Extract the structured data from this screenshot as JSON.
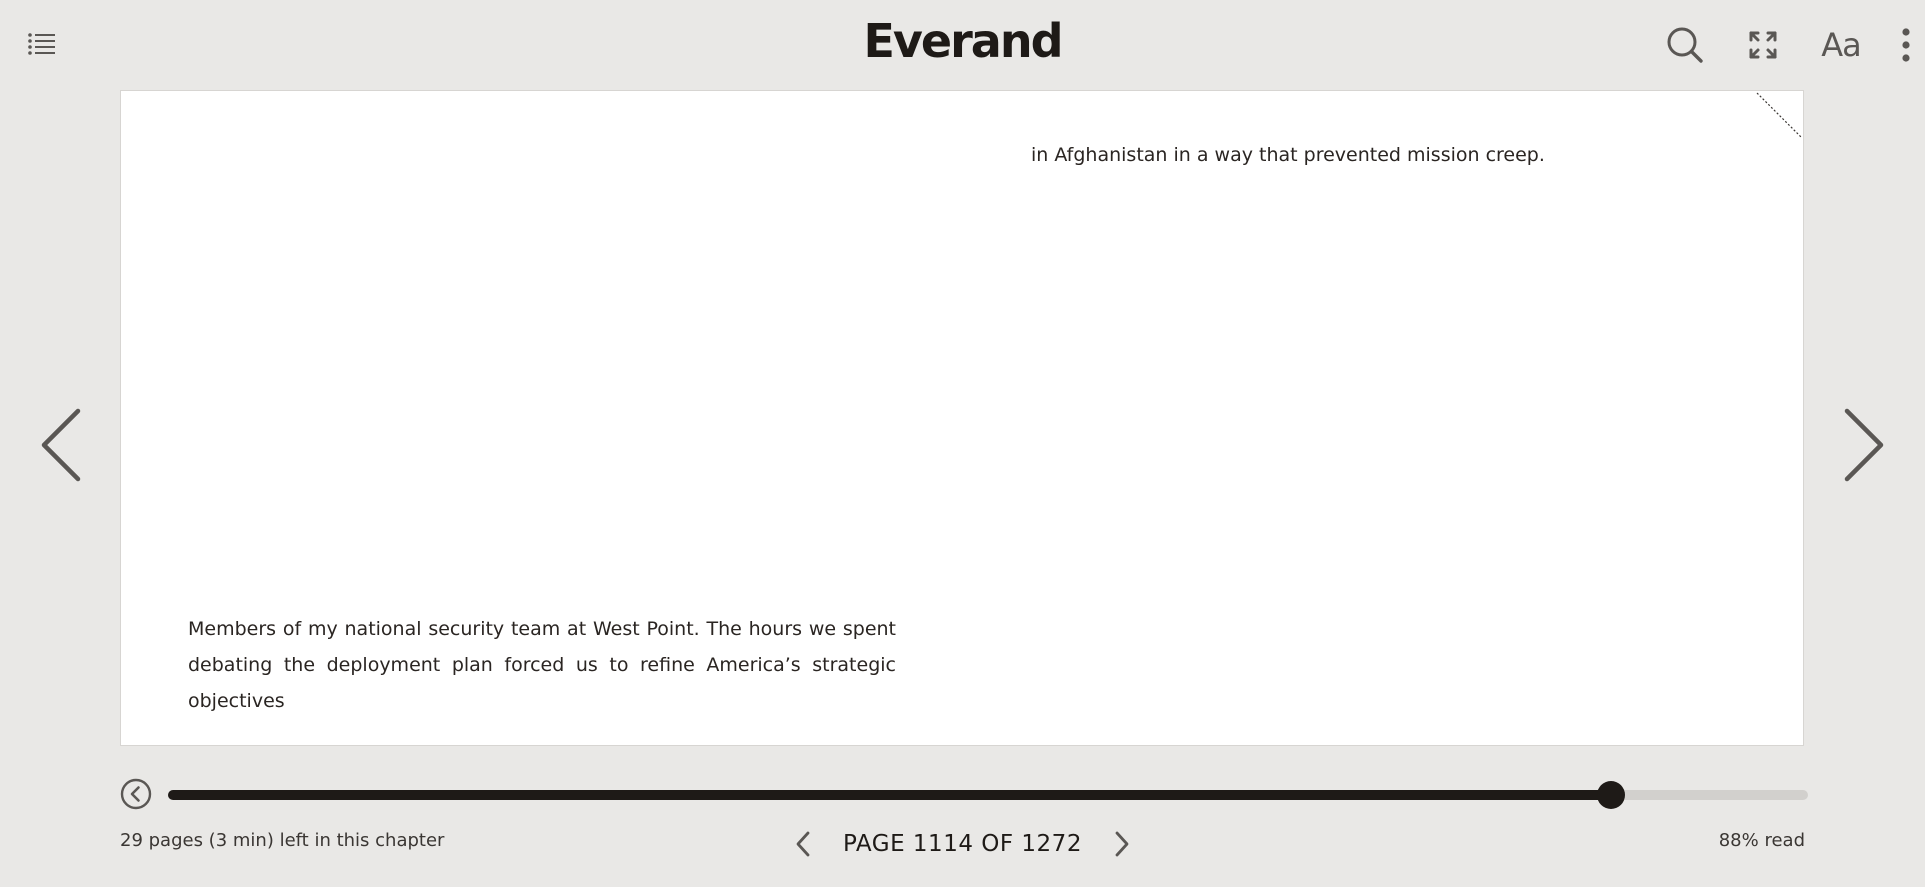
{
  "app": {
    "brand": "Everand"
  },
  "toolbar": {
    "toc_icon": "list-icon",
    "search_icon": "search-icon",
    "fullscreen_icon": "expand-icon",
    "font_label": "Aa",
    "more_icon": "more-vertical-icon"
  },
  "page": {
    "left_text_lines": [
      "Members of my national security team at West Point. The hours we spent",
      "debating the deployment plan forced us to refine America’s strategic objectives"
    ],
    "right_text": "in Afghanistan in a way that prevented mission creep."
  },
  "navigation": {
    "prev_icon": "chevron-left-icon",
    "next_icon": "chevron-right-icon"
  },
  "progress": {
    "percent_read": 88,
    "back_icon": "circle-chevron-left-icon"
  },
  "footer": {
    "chapter_status": "29 pages (3 min) left in this chapter",
    "page_label": "PAGE 1114 OF 1272",
    "read_label": "88% read"
  },
  "colors": {
    "background": "#e9e8e6",
    "page": "#ffffff",
    "ink": "#1e1a17",
    "icon": "#5a5754",
    "track": "#d2d0cd"
  }
}
